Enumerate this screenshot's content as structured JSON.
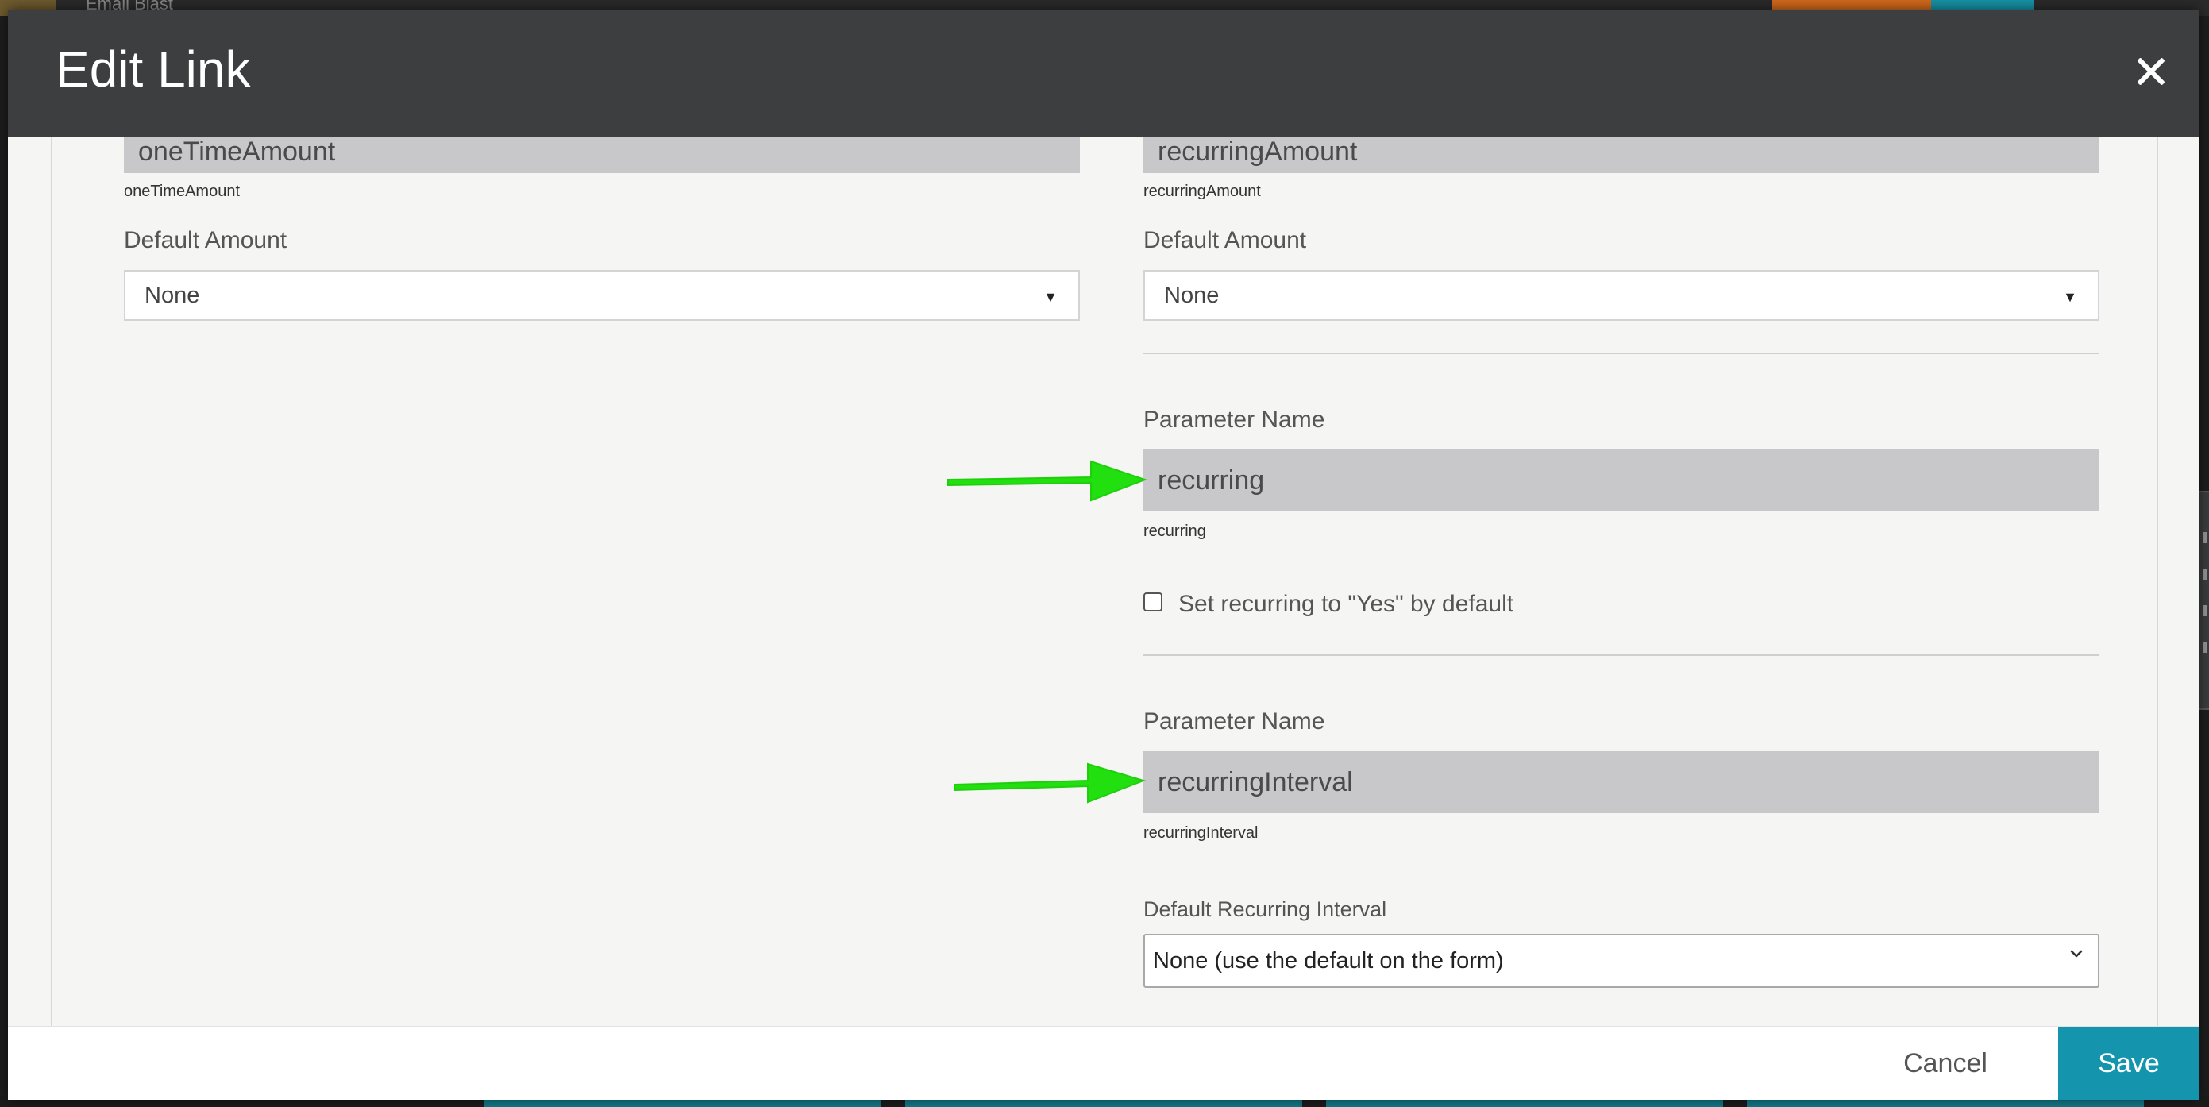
{
  "backdrop": {
    "text": "Email Blast"
  },
  "modal": {
    "title": "Edit Link"
  },
  "left_column": {
    "param_value": "oneTimeAmount",
    "param_hint": "oneTimeAmount",
    "default_amount_label": "Default Amount",
    "default_amount_value": "None"
  },
  "right_column": {
    "param_value": "recurringAmount",
    "param_hint": "recurringAmount",
    "default_amount_label": "Default Amount",
    "default_amount_value": "None",
    "recurring": {
      "label": "Parameter Name",
      "value": "recurring",
      "hint": "recurring",
      "checkbox_label": "Set recurring to \"Yes\" by default",
      "checked": false
    },
    "interval": {
      "label": "Parameter Name",
      "value": "recurringInterval",
      "hint": "recurringInterval",
      "default_label": "Default Recurring Interval",
      "default_value": "None (use the default on the form)"
    }
  },
  "annotations": {
    "arrow_color": "#22e010"
  },
  "footer": {
    "cancel_label": "Cancel",
    "save_label": "Save"
  },
  "colors": {
    "header_bg": "#3d3e40",
    "save_bg": "#1595ad",
    "readonly_bg": "#c8c8ca"
  }
}
